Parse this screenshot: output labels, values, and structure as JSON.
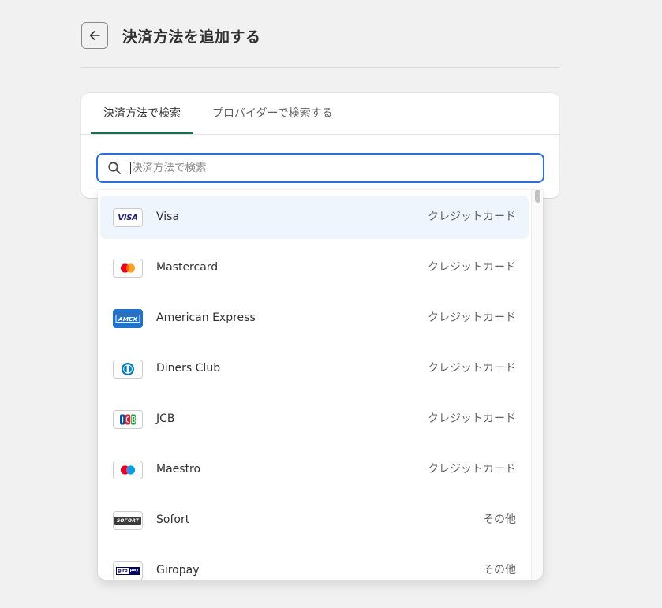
{
  "header": {
    "title": "決済方法を追加する"
  },
  "tabs": [
    {
      "label": "決済方法で検索",
      "active": true
    },
    {
      "label": "プロバイダーで検索する",
      "active": false
    }
  ],
  "search": {
    "value": "",
    "placeholder": "決済方法で検索"
  },
  "payment_methods": [
    {
      "name": "Visa",
      "category": "クレジットカード",
      "icon": "visa-logo-icon",
      "highlighted": true
    },
    {
      "name": "Mastercard",
      "category": "クレジットカード",
      "icon": "mastercard-logo-icon",
      "highlighted": false
    },
    {
      "name": "American Express",
      "category": "クレジットカード",
      "icon": "amex-logo-icon",
      "highlighted": false
    },
    {
      "name": "Diners Club",
      "category": "クレジットカード",
      "icon": "diners-club-logo-icon",
      "highlighted": false
    },
    {
      "name": "JCB",
      "category": "クレジットカード",
      "icon": "jcb-logo-icon",
      "highlighted": false
    },
    {
      "name": "Maestro",
      "category": "クレジットカード",
      "icon": "maestro-logo-icon",
      "highlighted": false
    },
    {
      "name": "Sofort",
      "category": "その他",
      "icon": "sofort-logo-icon",
      "highlighted": false
    },
    {
      "name": "Giropay",
      "category": "その他",
      "icon": "giropay-logo-icon",
      "highlighted": false
    }
  ],
  "logo_texts": {
    "visa": "VISA",
    "amex": "AMEX",
    "sofort": "SOFORT",
    "giropay_left": "giro",
    "giropay_right": "pay"
  },
  "colors": {
    "accent_tab_underline": "#1a6e4f",
    "search_focus_border": "#2b6ee0",
    "highlight_row": "#eff5fc",
    "page_background": "#f1f1f1"
  }
}
